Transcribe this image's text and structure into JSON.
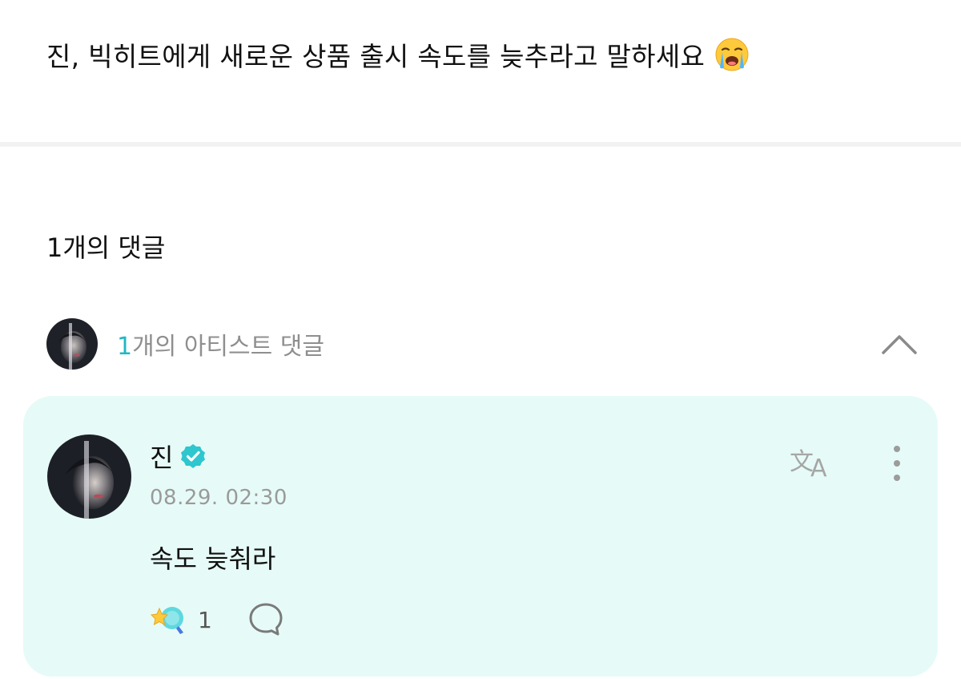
{
  "post": {
    "text": "진, 빅히트에게 새로운 상품 출시 속도를 늦추라고 말하세요"
  },
  "comments": {
    "count_label": "1개의 댓글"
  },
  "artist_comments": {
    "count": "1",
    "label_suffix": "개의 아티스트 댓글"
  },
  "comment": {
    "author": "진",
    "timestamp": "08.29. 02:30",
    "text": "속도 늦춰라",
    "cheer_count": "1"
  },
  "colors": {
    "accent_teal": "#20b8c2",
    "card_background": "#e6fbf7",
    "muted_text": "#9a9a9a"
  },
  "icons": {
    "post_emoji": "loudly-crying-face-icon",
    "verified": "verified-badge-icon",
    "translate": "translate-icon",
    "more": "more-vertical-icon",
    "collapse": "chevron-up-icon",
    "cheer": "cheer-reaction-icon",
    "reply": "speech-bubble-icon"
  }
}
